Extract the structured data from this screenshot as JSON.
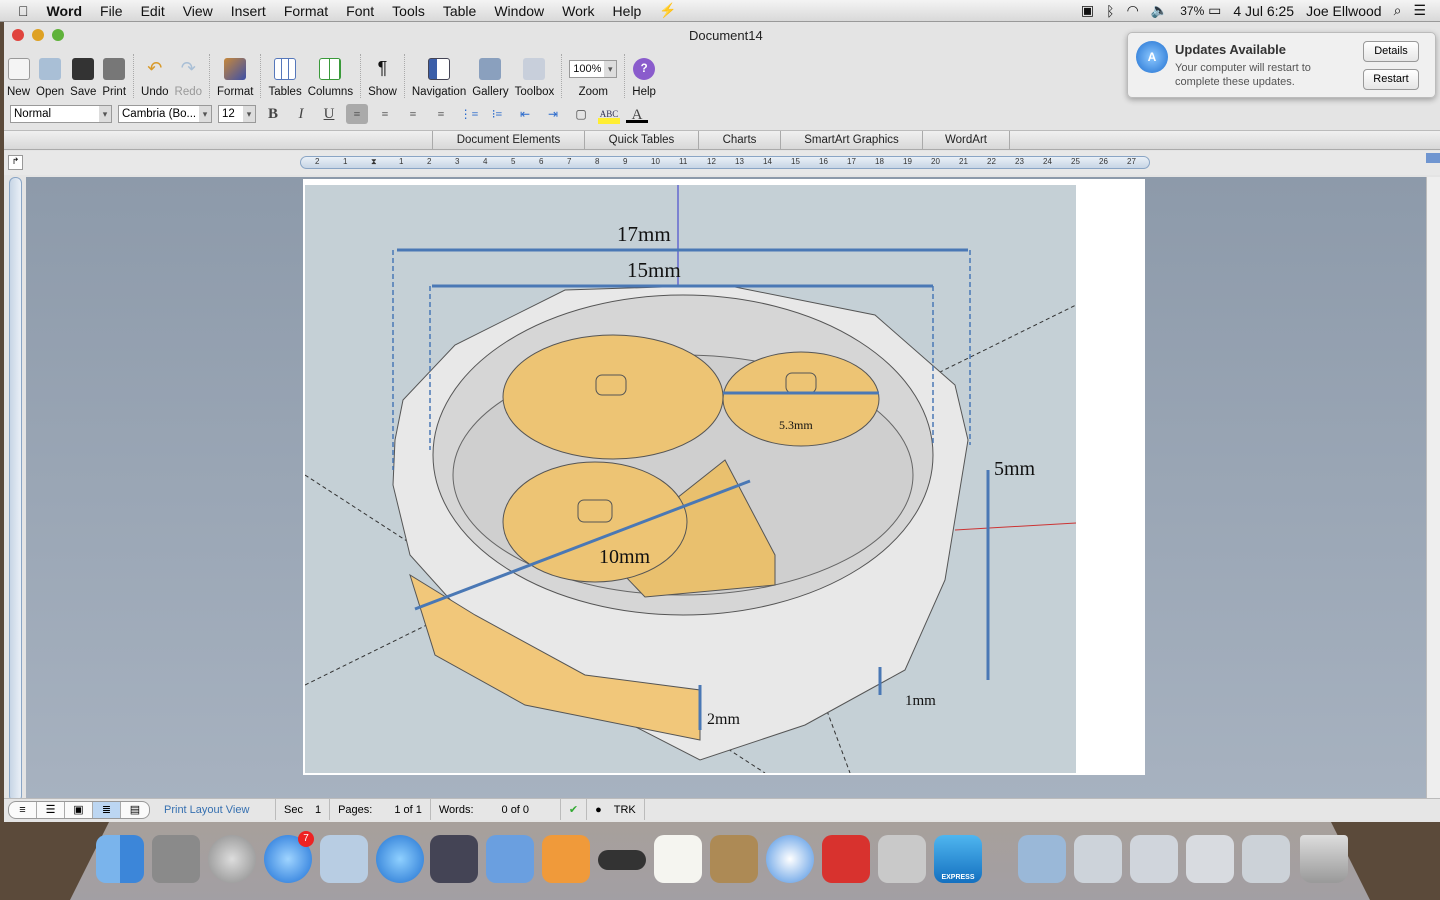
{
  "menubar": {
    "app": "Word",
    "items": [
      "File",
      "Edit",
      "View",
      "Insert",
      "Format",
      "Font",
      "Tools",
      "Table",
      "Window",
      "Work",
      "Help"
    ],
    "battery": "37%",
    "date": "4 Jul",
    "time": "6:25",
    "user": "Joe Ellwood"
  },
  "window": {
    "title": "Document14"
  },
  "toolbar": {
    "items": [
      "New",
      "Open",
      "Save",
      "Print",
      "Undo",
      "Redo",
      "Format",
      "Tables",
      "Columns",
      "Show",
      "Navigation",
      "Gallery",
      "Toolbox",
      "Zoom",
      "Help"
    ],
    "zoom": "100%"
  },
  "format": {
    "style": "Normal",
    "font": "Cambria (Bo...",
    "size": "12",
    "bold": "B",
    "italic": "I",
    "underline": "U"
  },
  "ribbon": {
    "tabs": [
      "Document Elements",
      "Quick Tables",
      "Charts",
      "SmartArt Graphics",
      "WordArt"
    ]
  },
  "ruler": {
    "ticks": [
      "2",
      "1",
      "",
      "1",
      "2",
      "3",
      "4",
      "5",
      "6",
      "7",
      "8",
      "9",
      "10",
      "11",
      "12",
      "13",
      "14",
      "15",
      "16",
      "17",
      "18",
      "19",
      "20",
      "21",
      "22",
      "23",
      "24",
      "25",
      "26",
      "27"
    ]
  },
  "figure": {
    "labels": {
      "d17": "17mm",
      "d15": "15mm",
      "d10": "10mm",
      "d53": "5.3mm",
      "d5": "5mm",
      "d2": "2mm",
      "d1": "1mm"
    },
    "colors": {
      "background": "#c5d0d6",
      "gear": "#ecc474",
      "dimension": "#4a78b5"
    }
  },
  "status": {
    "view": "Print Layout View",
    "sec_label": "Sec",
    "sec": "1",
    "pages_label": "Pages:",
    "pages": "1 of 1",
    "words_label": "Words:",
    "words": "0 of 0",
    "trk": "TRK"
  },
  "notification": {
    "title": "Updates Available",
    "body": "Your computer will restart to complete these updates.",
    "details": "Details",
    "restart": "Restart"
  },
  "dock": {
    "express_label": "EXPRESS",
    "badge": "7"
  }
}
